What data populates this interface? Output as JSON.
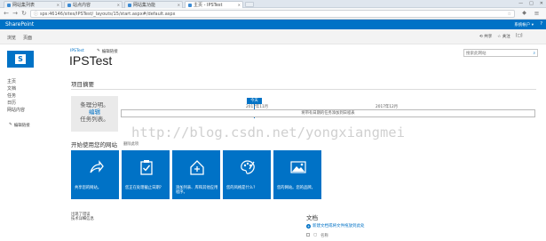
{
  "browser": {
    "tabs": [
      {
        "label": "网站集列表"
      },
      {
        "label": "站点内容"
      },
      {
        "label": "网站集功能"
      },
      {
        "label": "主页 - IPSTest"
      }
    ],
    "url": "sps:46146/sites/IPSTest/_layouts/15/start.aspx#/default.aspx"
  },
  "suite": {
    "brand": "SharePoint",
    "user_menu": "系统帐户 ▾",
    "nav": [
      "浏览",
      "页面"
    ],
    "actions": [
      "共享",
      "关注",
      "[□]"
    ]
  },
  "site": {
    "edit_links_top": "编辑链接",
    "subtitle": "IPSTest",
    "title": "IPSTest",
    "search_placeholder": "搜索此网站",
    "quicklaunch": [
      "主页",
      "文档",
      "任务",
      "日历",
      "网站内容"
    ],
    "edit_links_left": "编辑链接"
  },
  "summary": {
    "heading": "项目摘要",
    "no_tasks_line1": "条理分明。",
    "no_tasks_link": "编辑",
    "no_tasks_line2": "任务列表。",
    "today_badge": "今天",
    "month1": "2017年11月",
    "month2": "2017年12月",
    "timeline_text": "将带有日期的任务添加到日程表"
  },
  "getting_started": {
    "heading": "开始使用您的网站",
    "remove_link": "删除此项",
    "tiles": [
      {
        "caption": "共享您的网站。",
        "icon": "share-icon"
      },
      {
        "caption": "您正在处理截止日期?",
        "icon": "clipboard-check-icon"
      },
      {
        "caption": "添加列表、库和其他应用程序。",
        "icon": "add-app-icon"
      },
      {
        "caption": "您的风格是什么?",
        "icon": "palette-icon"
      },
      {
        "caption": "您的网站。您的品牌。",
        "icon": "picture-icon"
      }
    ]
  },
  "newsfeed": {
    "line1": "出现了错误",
    "line2": "技术详细信息"
  },
  "documents": {
    "heading": "文档",
    "new_link": "新建文档或将文件拖放到此处",
    "col_name": "名称"
  },
  "watermark": "http://blog.csdn.net/yongxiangmei"
}
